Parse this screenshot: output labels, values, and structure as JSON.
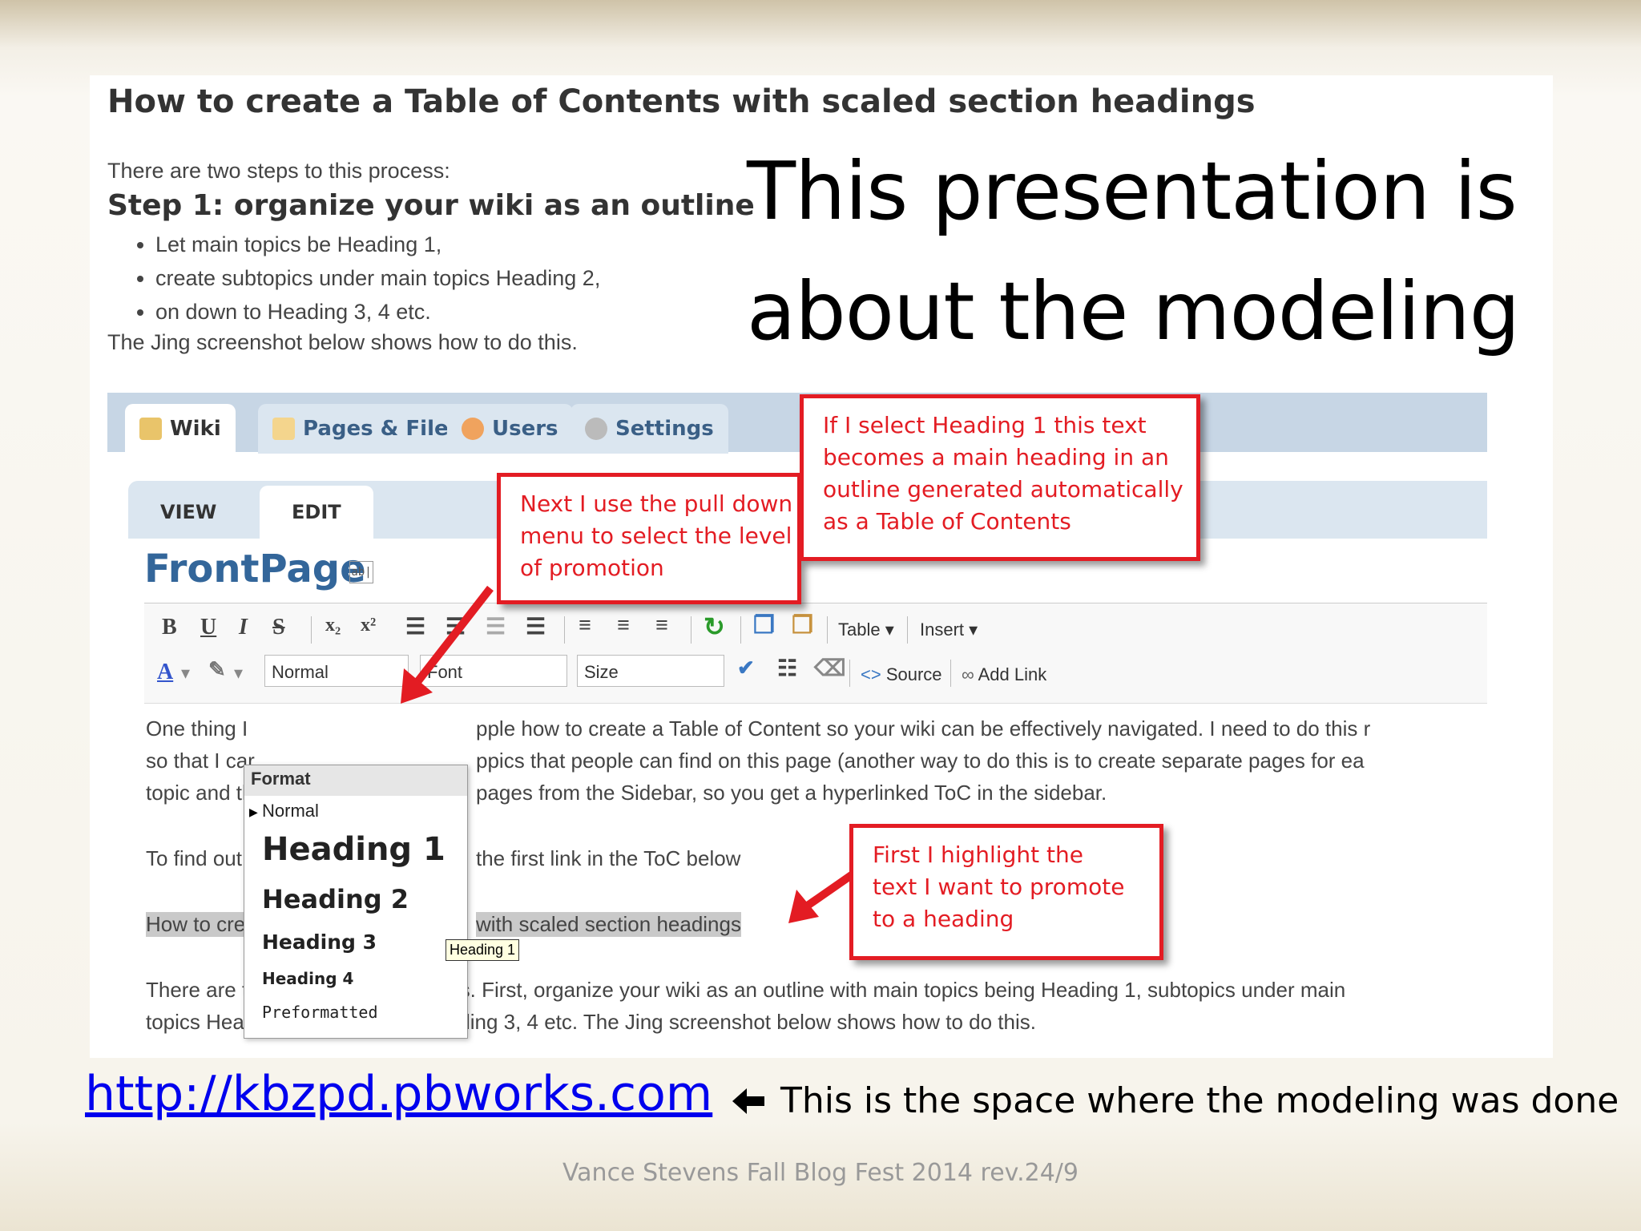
{
  "doc": {
    "title": "How to create a Table of Contents with scaled section headings",
    "intro": "There are two steps to this process:",
    "step1": "Step 1: organize your wiki as an outline",
    "bullets": [
      "Let main topics be Heading 1,",
      "create subtopics under main topics Heading 2,",
      "on down to Heading 3, 4 etc."
    ],
    "jing": "The Jing screenshot below shows how to do this."
  },
  "headline": {
    "line1": "This presentation is",
    "line2": "about the modeling"
  },
  "wiki": {
    "tabs": [
      "Wiki",
      "Pages & Files",
      "Users",
      "Settings"
    ],
    "subtabs": [
      "VIEW",
      "EDIT"
    ],
    "page_title": "FrontPage",
    "abl": "ab|",
    "toolbar": {
      "format_value": "Normal",
      "font_placeholder": "Font",
      "size_placeholder": "Size",
      "table": "Table",
      "insert": "Insert",
      "source": "Source",
      "add_link": "Add Link"
    },
    "body": [
      "One thing I",
      "pple how to create a Table of Content so your wiki can be effectively navigated. I need to do this r",
      "so that I car",
      "ppics that people can find on this page (another way to do this is to create separate pages for ea",
      "topic and th",
      " pages from the Sidebar, so you get a hyperlinked ToC in the sidebar.",
      "To find out",
      "the first link in the ToC below",
      "How to crea",
      " with scaled section headings",
      "There are two steps to this process. First, organize your wiki as an outline with main topics being Heading 1, subtopics under main",
      "topics Heading 2, on down to Heading 3, 4 etc. The Jing screenshot below shows how to do this."
    ],
    "dropdown": {
      "header": "Format",
      "items": [
        "Normal",
        "Heading 1",
        "Heading 2",
        "Heading 3",
        "Heading 4",
        "Preformatted"
      ],
      "tooltip": "Heading 1"
    }
  },
  "callouts": {
    "pulldown": [
      "Next I use the pull down",
      "menu to select the level",
      "of promotion"
    ],
    "heading1": [
      "If I select Heading 1 this text",
      "becomes a main heading in an",
      "outline generated automatically",
      "as a Table of Contents"
    ],
    "highlight": [
      "First I highlight the",
      "text I want to promote",
      "to a heading"
    ]
  },
  "link": "http://kbzpd.pbworks.com",
  "note": "This is the space where the modeling was done",
  "footer": "Vance Stevens Fall Blog Fest 2014 rev.24/9",
  "colors": {
    "callout_red": "#e31c23",
    "wiki_blue": "#33669a",
    "link_blue": "#0000ee"
  }
}
